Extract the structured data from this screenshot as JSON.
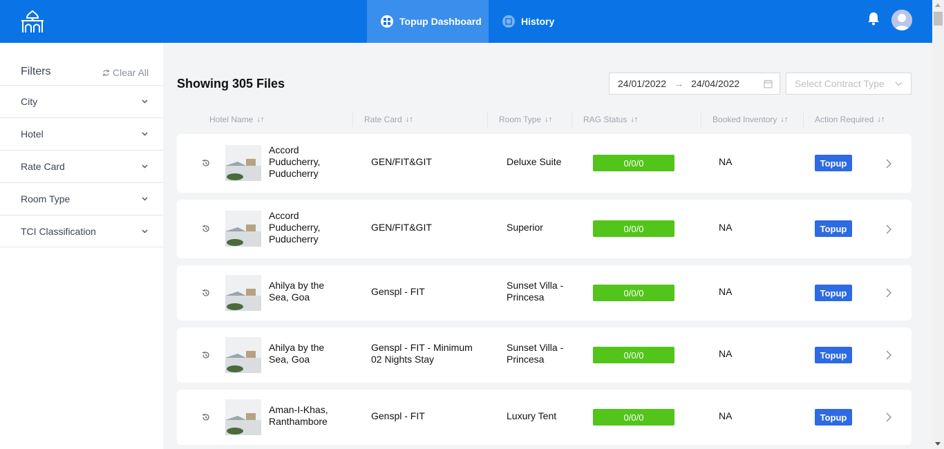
{
  "nav": {
    "tabs": [
      {
        "label": "Topup Dashboard",
        "icon": "dashboard-icon",
        "active": true
      },
      {
        "label": "History",
        "icon": "history-icon",
        "active": false
      }
    ],
    "icons": {
      "logo": "palace-logo-icon",
      "bell": "bell-icon",
      "avatar": "user-avatar-icon"
    }
  },
  "sidebar": {
    "title": "Filters",
    "clear_all": "Clear All",
    "items": [
      {
        "label": "City"
      },
      {
        "label": "Hotel"
      },
      {
        "label": "Rate Card"
      },
      {
        "label": "Room Type"
      },
      {
        "label": "TCI Classification"
      }
    ]
  },
  "main": {
    "heading": "Showing 305 Files",
    "date_from": "24/01/2022",
    "date_to": "24/04/2022",
    "date_arrow": "→",
    "contract_placeholder": "Select Contract Type",
    "columns": [
      {
        "label": "Hotel Name"
      },
      {
        "label": "Rate Card"
      },
      {
        "label": "Room Type"
      },
      {
        "label": "RAG Status"
      },
      {
        "label": "Booked Inventory"
      },
      {
        "label": "Action Required"
      }
    ],
    "rows": [
      {
        "hotel": "Accord Puducherry, Puducherry",
        "rate_card": "GEN/FIT&GIT",
        "room_type": "Deluxe Suite",
        "rag": "0/0/0",
        "booked": "NA",
        "action": "Topup"
      },
      {
        "hotel": "Accord Puducherry, Puducherry",
        "rate_card": "GEN/FIT&GIT",
        "room_type": "Superior",
        "rag": "0/0/0",
        "booked": "NA",
        "action": "Topup"
      },
      {
        "hotel": "Ahilya by the Sea, Goa",
        "rate_card": "Genspl - FIT",
        "room_type": "Sunset Villa - Princesa",
        "rag": "0/0/0",
        "booked": "NA",
        "action": "Topup"
      },
      {
        "hotel": "Ahilya by the Sea, Goa",
        "rate_card": "Genspl - FIT - Minimum 02 Nights Stay",
        "room_type": "Sunset Villa - Princesa",
        "rag": "0/0/0",
        "booked": "NA",
        "action": "Topup"
      },
      {
        "hotel": "Aman-I-Khas, Ranthambore",
        "rate_card": "Genspl - FIT",
        "room_type": "Luxury Tent",
        "rag": "0/0/0",
        "booked": "NA",
        "action": "Topup"
      }
    ]
  },
  "colors": {
    "primary": "#0a74e6",
    "rag_green": "#52c41a",
    "topup_blue": "#2d6ae3"
  }
}
